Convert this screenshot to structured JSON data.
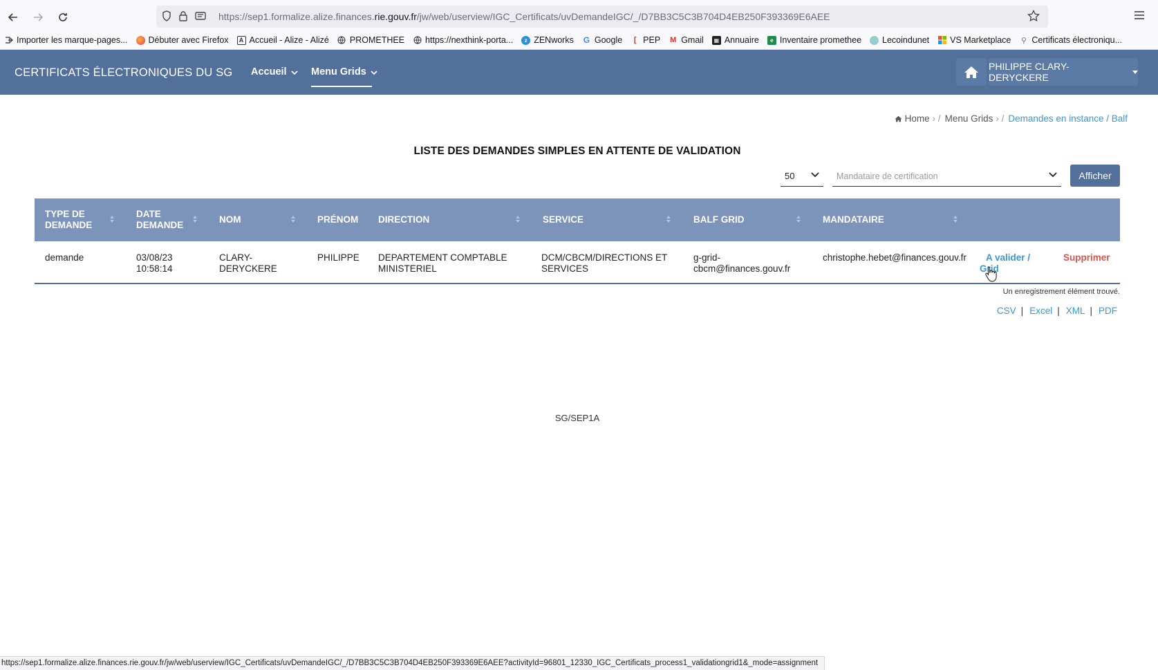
{
  "browser": {
    "url_prefix": "https://sep1.formalize.alize.finances.",
    "url_domain": "rie.gouv.fr",
    "url_path": "/jw/web/userview/IGC_Certificats/uvDemandeIGC/_/D7BB3C5C3B704D4EB250F393369E6AEE",
    "bookmarks": [
      {
        "label": "Importer les marque-pages...",
        "icon": "import-icon"
      },
      {
        "label": "Débuter avec Firefox",
        "icon": "firefox-icon"
      },
      {
        "label": "Accueil - Alize - Alizé",
        "icon": "alize-icon"
      },
      {
        "label": "PROMETHEE",
        "icon": "globe-icon"
      },
      {
        "label": "https://nexthink-porta...",
        "icon": "globe-icon"
      },
      {
        "label": "ZENworks",
        "icon": "zenworks-icon"
      },
      {
        "label": "Google",
        "icon": "google-icon"
      },
      {
        "label": "PEP",
        "icon": "pep-icon"
      },
      {
        "label": "Gmail",
        "icon": "gmail-icon"
      },
      {
        "label": "Annuaire",
        "icon": "annuaire-icon"
      },
      {
        "label": "Inventaire promethee",
        "icon": "inventaire-icon"
      },
      {
        "label": "Lecoindunet",
        "icon": "lecoindunet-icon"
      },
      {
        "label": "VS Marketplace",
        "icon": "microsoft-icon"
      },
      {
        "label": "Certificats électroniqu...",
        "icon": "certificat-icon"
      }
    ],
    "status_url": "https://sep1.formalize.alize.finances.rie.gouv.fr/jw/web/userview/IGC_Certificats/uvDemandeIGC/_/D7BB3C5C3B704D4EB250F393369E6AEE?activityId=96801_12330_IGC_Certificats_process1_validationgrid1&_mode=assignment"
  },
  "header": {
    "brand": "CERTIFICATS ÉLECTRONIQUES DU SG",
    "nav": [
      "Accueil",
      "Menu Grids"
    ],
    "user": "PHILIPPE CLARY-DERYCKERE",
    "colors": {
      "bar": "#53709b",
      "table_head": "#7c94b9",
      "link": "#3a97d4",
      "danger": "#d9534f"
    }
  },
  "breadcrumb": {
    "home": "Home",
    "menu": "Menu Grids",
    "current": "Demandes en instance / Balf"
  },
  "main": {
    "title": "LISTE DES DEMANDES SIMPLES EN ATTENTE DE VALIDATION",
    "page_size": "50",
    "mandataire_placeholder": "Mandataire de certification",
    "afficher": "Afficher",
    "columns": [
      {
        "line1": "TYPE DE",
        "line2": "DEMANDE"
      },
      {
        "line1": "DATE",
        "line2": "DEMANDE"
      },
      {
        "line1": "NOM",
        "line2": ""
      },
      {
        "line1": "PRÉNOM",
        "line2": ""
      },
      {
        "line1": "DIRECTION",
        "line2": ""
      },
      {
        "line1": "SERVICE",
        "line2": ""
      },
      {
        "line1": "BALF GRID",
        "line2": ""
      },
      {
        "line1": "MANDATAIRE",
        "line2": ""
      }
    ],
    "rows": [
      {
        "type": "demande",
        "date_l1": "03/08/23",
        "date_l2": "10:58:14",
        "nom_l1": "CLARY-",
        "nom_l2": "DERYCKERE",
        "prenom": "PHILIPPE",
        "direction_l1": "DEPARTEMENT COMPTABLE",
        "direction_l2": "MINISTERIEL",
        "service_l1": "DCM/CBCM/DIRECTIONS ET",
        "service_l2": "SERVICES",
        "balf_l1": "g-grid-",
        "balf_l2": "cbcm@finances.gouv.fr",
        "mandataire": "christophe.hebet@finances.gouv.fr",
        "action_l1": "A valider /",
        "action_l2": "Grid",
        "delete": "Supprimer"
      }
    ],
    "found": "Un enregistrement élément trouvé.",
    "exports": [
      "CSV",
      "Excel",
      "XML",
      "PDF"
    ]
  },
  "footer": {
    "text": "SG/SEP1A"
  }
}
